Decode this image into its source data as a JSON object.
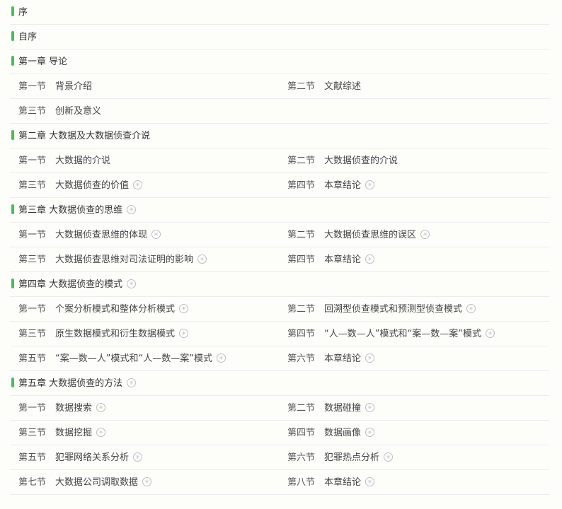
{
  "toc": {
    "preface": {
      "label": "序"
    },
    "self_preface": {
      "label": "自序"
    },
    "chapters": [
      {
        "title": "第一章 导论",
        "locked": false,
        "sections": [
          {
            "num": "第一节",
            "title": "背景介绍",
            "locked": false
          },
          {
            "num": "第二节",
            "title": "文献综述",
            "locked": false
          },
          {
            "num": "第三节",
            "title": "创新及意义",
            "locked": false
          }
        ]
      },
      {
        "title": "第二章 大数据及大数据侦查介说",
        "locked": false,
        "sections": [
          {
            "num": "第一节",
            "title": "大数据的介说",
            "locked": false
          },
          {
            "num": "第二节",
            "title": "大数据侦查的介说",
            "locked": false
          },
          {
            "num": "第三节",
            "title": "大数据侦查的价值",
            "locked": true
          },
          {
            "num": "第四节",
            "title": "本章结论",
            "locked": true
          }
        ]
      },
      {
        "title": "第三章 大数据侦查的思维",
        "locked": true,
        "sections": [
          {
            "num": "第一节",
            "title": "大数据侦查思维的体现",
            "locked": true
          },
          {
            "num": "第二节",
            "title": "大数据侦查思维的误区",
            "locked": true
          },
          {
            "num": "第三节",
            "title": "大数据侦查思维对司法证明的影响",
            "locked": true
          },
          {
            "num": "第四节",
            "title": "本章结论",
            "locked": true
          }
        ]
      },
      {
        "title": "第四章 大数据侦查的模式",
        "locked": true,
        "sections": [
          {
            "num": "第一节",
            "title": "个案分析模式和整体分析模式",
            "locked": true
          },
          {
            "num": "第二节",
            "title": "回溯型侦查模式和预测型侦查模式",
            "locked": true
          },
          {
            "num": "第三节",
            "title": "原生数据模式和衍生数据模式",
            "locked": true
          },
          {
            "num": "第四节",
            "title": "“人—数—人”模式和“案—数—案”模式",
            "locked": true
          },
          {
            "num": "第五节",
            "title": "“案—数—人”模式和“人—数—案”模式",
            "locked": true
          },
          {
            "num": "第六节",
            "title": "本章结论",
            "locked": true
          }
        ]
      },
      {
        "title": "第五章 大数据侦查的方法",
        "locked": true,
        "sections": [
          {
            "num": "第一节",
            "title": "数据搜索",
            "locked": true
          },
          {
            "num": "第二节",
            "title": "数据碰撞",
            "locked": true
          },
          {
            "num": "第三节",
            "title": "数据挖掘",
            "locked": true
          },
          {
            "num": "第四节",
            "title": "数据画像",
            "locked": true
          },
          {
            "num": "第五节",
            "title": "犯罪网络关系分析",
            "locked": true
          },
          {
            "num": "第六节",
            "title": "犯罪热点分析",
            "locked": true
          },
          {
            "num": "第七节",
            "title": "大数据公司调取数据",
            "locked": true
          },
          {
            "num": "第八节",
            "title": "本章结论",
            "locked": true
          }
        ]
      }
    ]
  },
  "icons": {
    "lock": "lock-icon"
  },
  "colors": {
    "accent": "#4cbb58",
    "divider": "#ececec",
    "background": "#fdfdfa"
  }
}
